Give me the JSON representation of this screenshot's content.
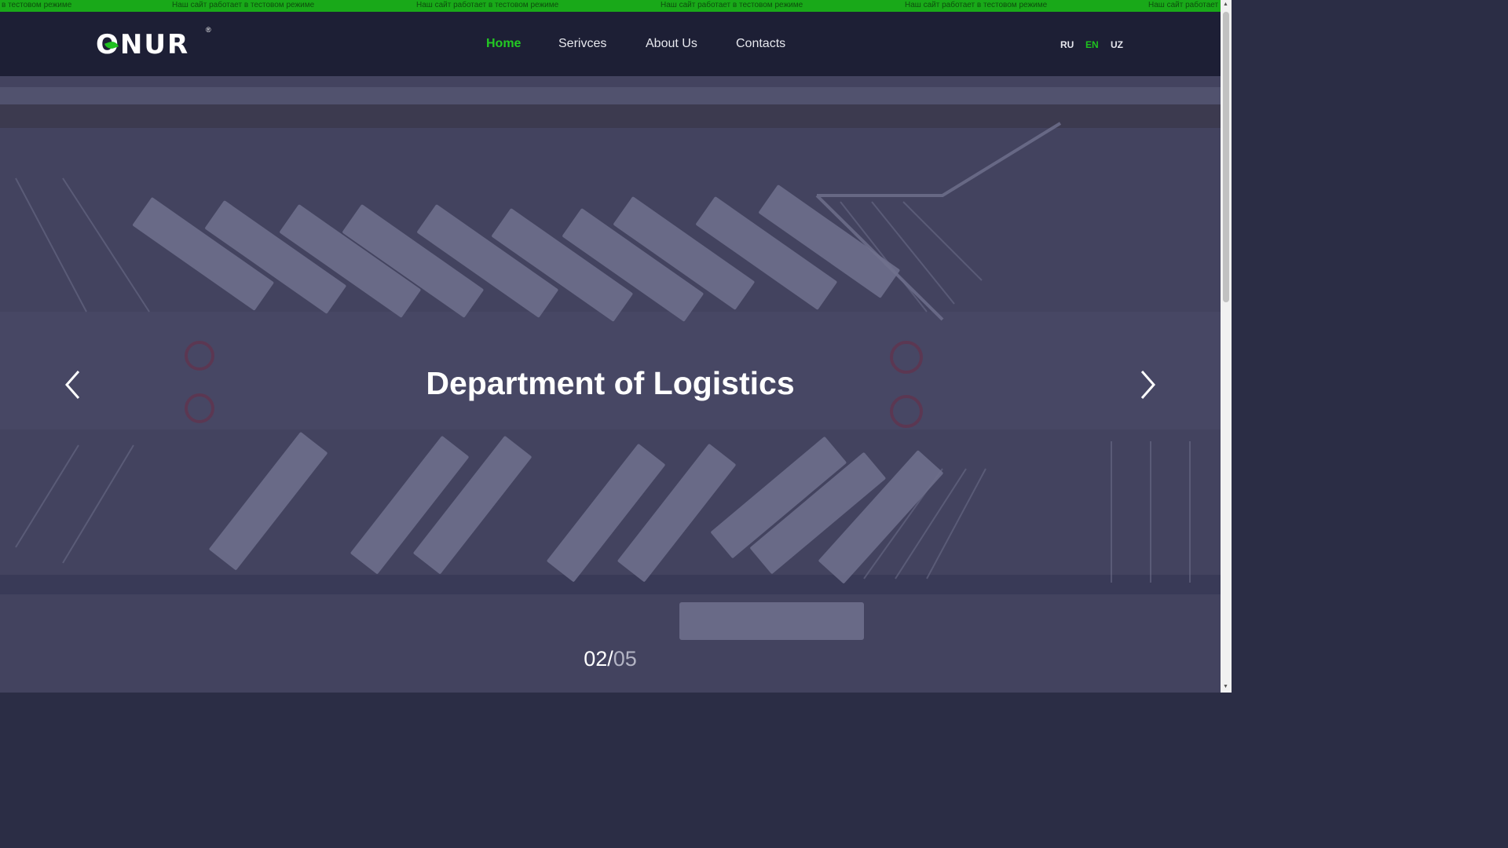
{
  "ticker": {
    "items": [
      "в тестовом режиме",
      "Наш сайт работает в тестовом режиме",
      "Наш сайт работает в тестовом режиме",
      "Наш сайт работает в тестовом режиме",
      "Наш сайт работает в тестовом режиме",
      "Наш сайт работает"
    ]
  },
  "header": {
    "logo_text": "ONUR",
    "logo_reg": "®",
    "nav": [
      {
        "label": "Home",
        "active": true
      },
      {
        "label": "Serivces",
        "active": false
      },
      {
        "label": "About Us",
        "active": false
      },
      {
        "label": "Contacts",
        "active": false
      }
    ],
    "languages": [
      {
        "label": "RU",
        "active": false
      },
      {
        "label": "EN",
        "active": true
      },
      {
        "label": "UZ",
        "active": false
      }
    ]
  },
  "hero": {
    "title": "Department of Logistics",
    "slide_current": "02",
    "slide_separator": "/",
    "slide_total": "05"
  },
  "colors": {
    "brand_green": "#1fbf1f",
    "header_bg": "#1d1f35",
    "overlay": "#262854"
  },
  "icons": {
    "prev": "chevron-left-icon",
    "next": "chevron-right-icon",
    "call": "phone-icon"
  }
}
